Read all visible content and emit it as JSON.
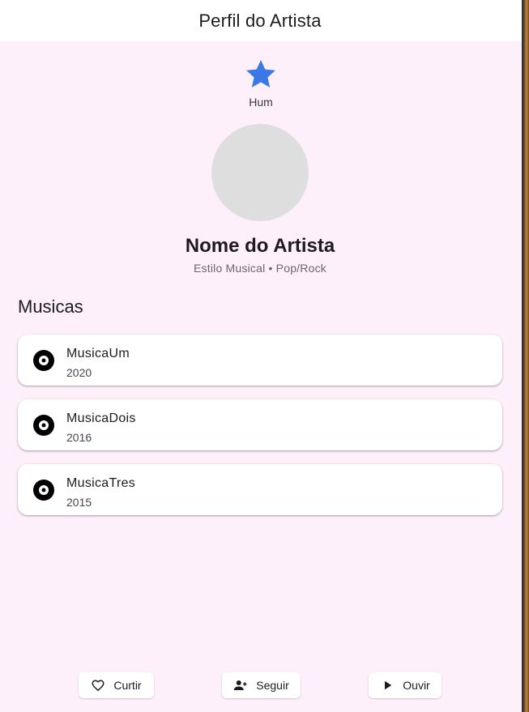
{
  "app_bar": {
    "title": "Perfil do Artista"
  },
  "badge": {
    "icon": "star-icon",
    "label": "Hum",
    "color": "#3b78e7"
  },
  "artist": {
    "name": "Nome do Artista",
    "genre": "Estilo Musical • Pop/Rock"
  },
  "songs_section": {
    "title": "Musicas",
    "items": [
      {
        "title": "MusicaUm",
        "year": "2020",
        "icon": "disc-icon"
      },
      {
        "title": "MusicaDois",
        "year": "2016",
        "icon": "disc-icon"
      },
      {
        "title": "MusicaTres",
        "year": "2015",
        "icon": "disc-icon"
      }
    ]
  },
  "actions": {
    "like": {
      "label": "Curtir",
      "icon": "heart-outline-icon"
    },
    "follow": {
      "label": "Seguir",
      "icon": "person-add-icon"
    },
    "listen": {
      "label": "Ouvir",
      "icon": "play-icon"
    }
  }
}
